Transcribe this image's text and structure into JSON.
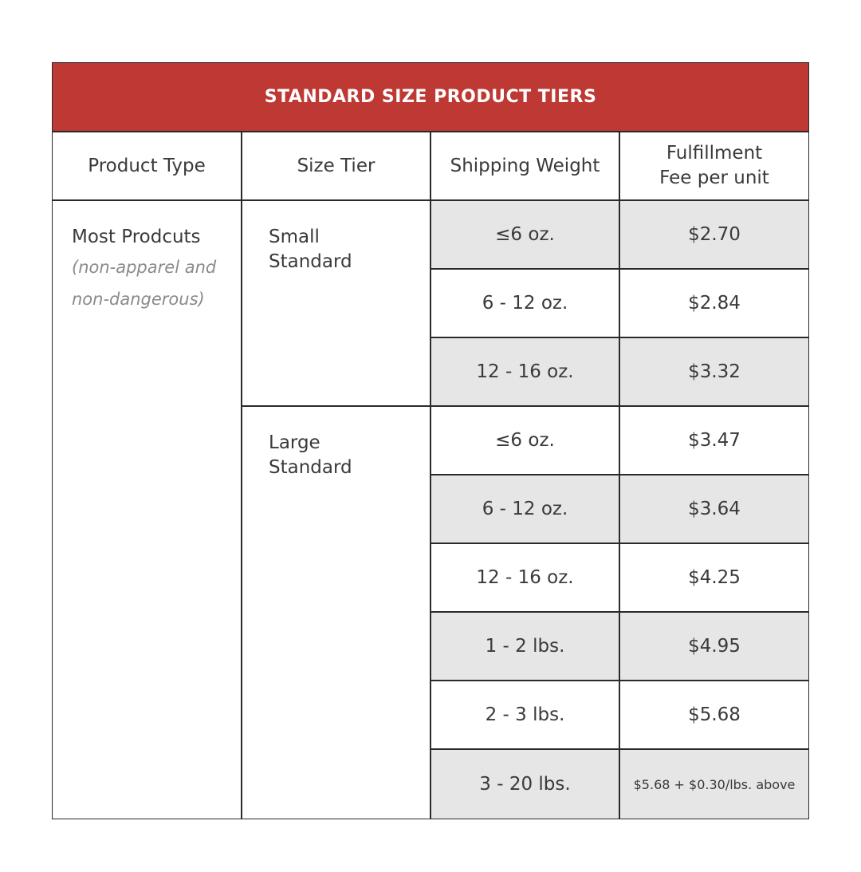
{
  "title": "STANDARD SIZE PRODUCT TIERS",
  "headers": {
    "product_type": "Product Type",
    "size_tier": "Size Tier",
    "shipping_weight": "Shipping Weight",
    "fee_line1": "Fulfillment",
    "fee_line2": "Fee per unit"
  },
  "product_type": {
    "name": "Most Prodcuts",
    "note_line1": "(non-apparel and",
    "note_line2": "non-dangerous)"
  },
  "tiers": {
    "small": {
      "line1": "Small",
      "line2": "Standard"
    },
    "large": {
      "line1": "Large",
      "line2": "Standard"
    }
  },
  "rows": [
    {
      "weight": "≤6 oz.",
      "fee": "$2.70"
    },
    {
      "weight": "6 - 12 oz.",
      "fee": "$2.84"
    },
    {
      "weight": "12 - 16 oz.",
      "fee": "$3.32"
    },
    {
      "weight": "≤6 oz.",
      "fee": "$3.47"
    },
    {
      "weight": "6 - 12 oz.",
      "fee": "$3.64"
    },
    {
      "weight": "12 - 16 oz.",
      "fee": "$4.25"
    },
    {
      "weight": "1 - 2 lbs.",
      "fee": "$4.95"
    },
    {
      "weight": "2 - 3 lbs.",
      "fee": "$5.68"
    },
    {
      "weight": "3 - 20 lbs.",
      "fee": "$5.68 + $0.30/lbs. above"
    }
  ],
  "colors": {
    "header_bg": "#be3834",
    "shade_bg": "#e6e6e6"
  }
}
